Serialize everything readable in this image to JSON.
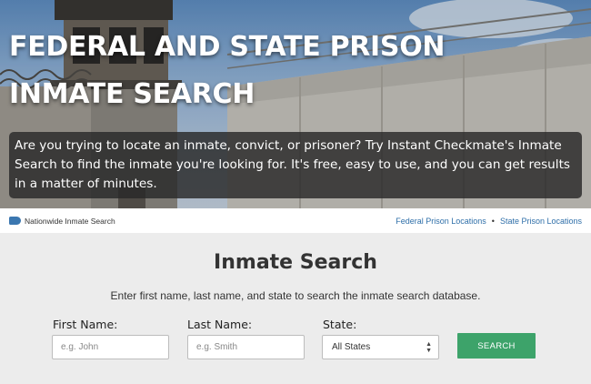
{
  "hero": {
    "title": "FEDERAL AND STATE PRISON INMATE SEARCH",
    "description": "Are you trying to locate an inmate, convict, or prisoner? Try Instant Checkmate's Inmate Search to find the inmate you're looking for. It's free, easy to use, and you can get results in a matter of minutes."
  },
  "breadcrumb": {
    "current": "Nationwide Inmate Search",
    "links": [
      "Federal Prison Locations",
      "State Prison Locations"
    ],
    "separator": "•"
  },
  "search": {
    "title": "Inmate Search",
    "subtitle": "Enter first name, last name, and state to search the inmate search database.",
    "first_name": {
      "label": "First Name:",
      "value": "",
      "placeholder": "e.g. John"
    },
    "last_name": {
      "label": "Last Name:",
      "value": "",
      "placeholder": "e.g. Smith"
    },
    "state": {
      "label": "State:",
      "selected": "All States"
    },
    "button_label": "SEARCH"
  },
  "colors": {
    "link": "#2f6fa9",
    "button": "#3da36a",
    "tag_icon": "#3b77b0"
  },
  "icons": [
    "tag-icon",
    "select-arrows-icon"
  ]
}
